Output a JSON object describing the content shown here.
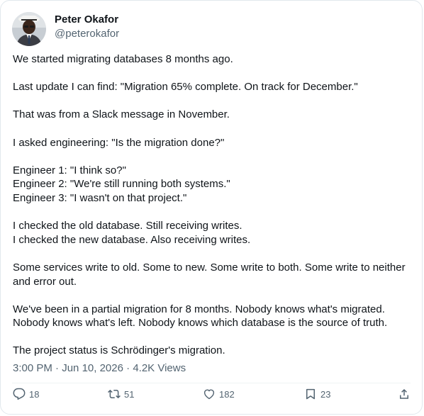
{
  "author": {
    "display_name": "Peter Okafor",
    "handle": "@peterokafor"
  },
  "post": {
    "paragraphs": [
      "We started migrating databases 8 months ago.",
      "Last update I can find: \"Migration 65% complete. On track for December.\"",
      "That was from a Slack message in November.",
      "I asked engineering: \"Is the migration done?\"",
      "Engineer 1: \"I think so?\"\nEngineer 2: \"We're still running both systems.\"\nEngineer 3: \"I wasn't on that project.\"",
      "I checked the old database. Still receiving writes.\nI checked the new database. Also receiving writes.",
      "Some services write to old. Some to new. Some write to both. Some write to neither and error out.",
      "We've been in a partial migration for 8 months. Nobody knows what's migrated. Nobody knows what's left. Nobody knows which database is the source of truth.",
      "The project status is Schrödinger's migration."
    ]
  },
  "meta": {
    "time": "3:00 PM",
    "separator": "·",
    "date": "Jun 10, 2026",
    "views": "4.2K Views"
  },
  "actions": {
    "reply_count": "18",
    "retweet_count": "51",
    "like_count": "182",
    "bookmark_count": "23"
  },
  "colors": {
    "text_primary": "#0f1419",
    "text_secondary": "#536471",
    "border": "#e1e8ed",
    "divider": "#eff3f4"
  },
  "icons": {
    "reply": "speech-bubble-icon",
    "retweet": "retweet-arrows-icon",
    "like": "heart-icon",
    "bookmark": "bookmark-icon",
    "share": "share-upload-icon"
  }
}
